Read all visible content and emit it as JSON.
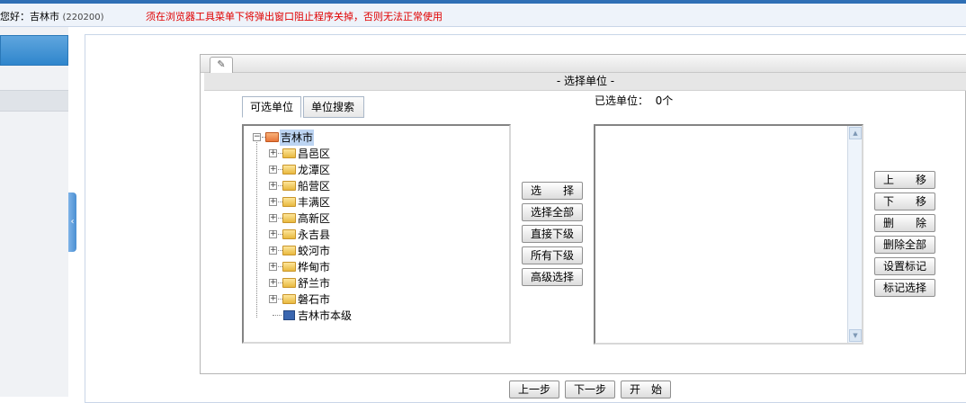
{
  "header": {
    "greeting": "您好：吉林市",
    "region_code": "(220200)",
    "warning": "须在浏览器工具菜单下将弹出窗口阻止程序关掉，否则无法正常使用"
  },
  "left": {
    "collapse_glyph": "‹"
  },
  "dialog": {
    "icon": "✎",
    "title": "- 选择单位 -"
  },
  "tabs": [
    "可选单位",
    "单位搜索"
  ],
  "tree": {
    "root": {
      "toggle": "−",
      "label": "吉林市"
    },
    "children": [
      {
        "toggle": "+",
        "label": "昌邑区"
      },
      {
        "toggle": "+",
        "label": "龙潭区"
      },
      {
        "toggle": "+",
        "label": "船营区"
      },
      {
        "toggle": "+",
        "label": "丰满区"
      },
      {
        "toggle": "+",
        "label": "高新区"
      },
      {
        "toggle": "+",
        "label": "永吉县"
      },
      {
        "toggle": "+",
        "label": "蛟河市"
      },
      {
        "toggle": "+",
        "label": "桦甸市"
      },
      {
        "toggle": "+",
        "label": "舒兰市"
      },
      {
        "toggle": "+",
        "label": "磐石市"
      }
    ],
    "leaf": {
      "label": "吉林市本级"
    }
  },
  "selected": {
    "label": "已选单位：",
    "count": "0个",
    "scroll_up": "▲",
    "scroll_down": "▼"
  },
  "middle_buttons": [
    "选　　择",
    "选择全部",
    "直接下级",
    "所有下级",
    "高级选择"
  ],
  "right_buttons": [
    "上　　移",
    "下　　移",
    "删　　除",
    "删除全部",
    "设置标记",
    "标记选择"
  ],
  "nav_buttons": [
    "上一步",
    "下一步",
    "开　始"
  ],
  "colors": {
    "topbar": "#2f6fb5",
    "warning": "#e00000",
    "left_head": "#2f86cc"
  }
}
